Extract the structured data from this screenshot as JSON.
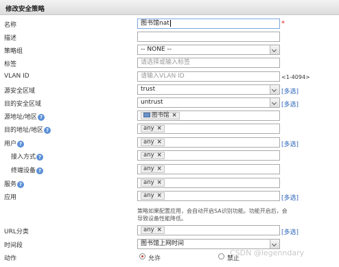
{
  "header": {
    "title": "修改安全策略"
  },
  "form": {
    "name": {
      "label": "名称",
      "value": "图书馆nat",
      "required_mark": "*"
    },
    "description": {
      "label": "描述",
      "value": ""
    },
    "policy_group": {
      "label": "策略组",
      "value": "-- NONE --"
    },
    "tag": {
      "label": "标签",
      "placeholder": "请选择或输入标签"
    },
    "vlan_id": {
      "label": "VLAN ID",
      "placeholder": "请输入VLAN ID",
      "range_hint": "<1-4094>"
    },
    "src_zone": {
      "label": "源安全区域",
      "value": "trust",
      "multi": "[多选]"
    },
    "dst_zone": {
      "label": "目的安全区域",
      "value": "untrust",
      "multi": "[多选]"
    },
    "src_addr": {
      "label": "源地址/地区",
      "tag": "图书馆"
    },
    "dst_addr": {
      "label": "目的地址/地区",
      "tag": "any"
    },
    "user": {
      "label": "用户",
      "tag": "any",
      "multi": "[多选]"
    },
    "access_method": {
      "label": "接入方式",
      "tag": "any"
    },
    "terminal": {
      "label": "终端设备",
      "tag": "any"
    },
    "service": {
      "label": "服务",
      "tag": "any"
    },
    "application": {
      "label": "应用",
      "tag": "any",
      "multi": "[多选]",
      "note": "策略如果配置应用，会自动开启SA识别功能。功能开启后，会导致设备性能降低。"
    },
    "url_category": {
      "label": "URL分类",
      "tag": "any",
      "multi": "[多选]"
    },
    "time_range": {
      "label": "时间段",
      "value": "图书馆上网时间"
    },
    "action": {
      "label": "动作",
      "options": [
        "允许",
        "禁止"
      ],
      "selected": "允许"
    }
  },
  "watermark": "CSDN @legenndary",
  "colors": {
    "link": "#2a62b8",
    "required": "#e02020",
    "help": "#5b8fd6"
  }
}
